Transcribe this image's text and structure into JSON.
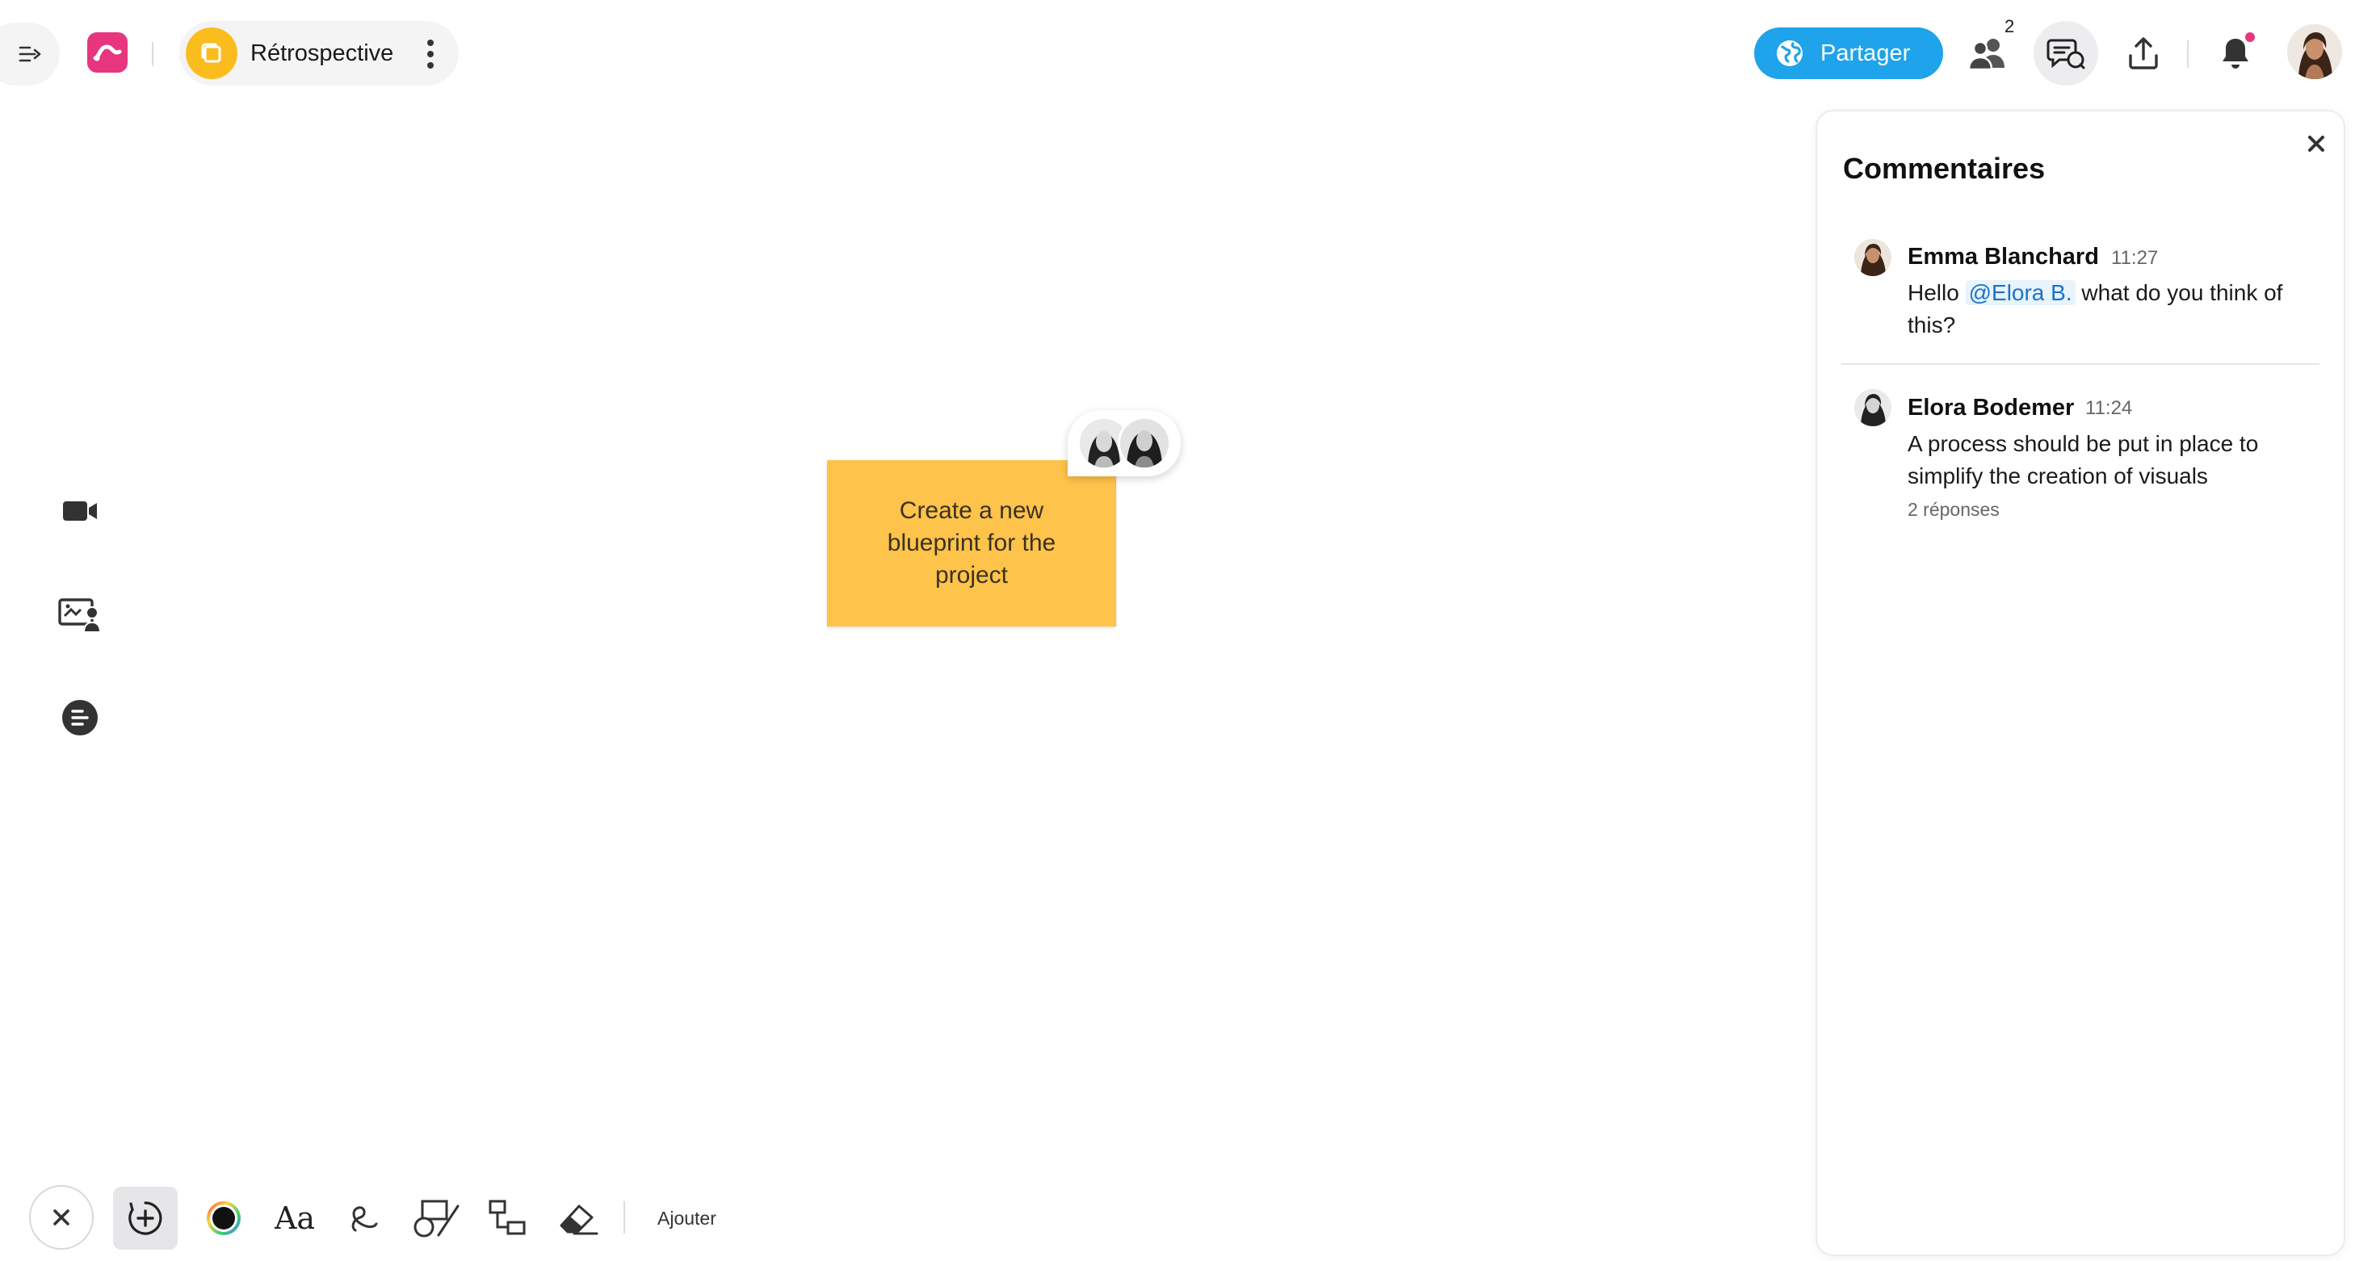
{
  "app": {
    "nav_toggle_icon": "collapse-right-icon",
    "logo_icon": "app-logo-icon",
    "brand_color": "#e8367e"
  },
  "board": {
    "title": "Rétrospective",
    "icon": "board-folder-icon",
    "icon_color": "#fbbd1e",
    "menu_icon": "more-vertical-icon"
  },
  "header": {
    "share_label": "Partager",
    "share_icon": "globe-icon",
    "share_color": "#1fa3ea",
    "users_icon": "users-icon",
    "users_count": "2",
    "comments_icon": "comments-icon",
    "upload_icon": "upload-icon",
    "notifications_icon": "bell-icon",
    "notification_dot_color": "#e8367e",
    "profile_icon": "user-avatar"
  },
  "left_rail": {
    "items": [
      {
        "name": "video-icon"
      },
      {
        "name": "presenter-icon"
      },
      {
        "name": "outline-icon"
      }
    ]
  },
  "canvas": {
    "sticky_text": "Create a new blueprint for the project",
    "sticky_color": "#fdc34a"
  },
  "toolbar": {
    "close_icon": "close-icon",
    "add_icon": "add-circle-icon",
    "color_icon": "color-wheel-icon",
    "text_label": "Aa",
    "pen_icon": "pen-icon",
    "shapes_icon": "shapes-icon",
    "connector_icon": "connector-icon",
    "eraser_icon": "eraser-icon",
    "add_label": "Ajouter"
  },
  "comments": {
    "title": "Commentaires",
    "close_icon": "close-icon",
    "items": [
      {
        "author": "Emma Blanchard",
        "time": "11:27",
        "text_before": "Hello",
        "mention": "@Elora B.",
        "text_after": "what do you think of this?"
      },
      {
        "author": "Elora Bodemer",
        "time": "11:24",
        "text": "A process should be put in place to simplify the creation of visuals",
        "replies": "2 réponses"
      }
    ]
  }
}
